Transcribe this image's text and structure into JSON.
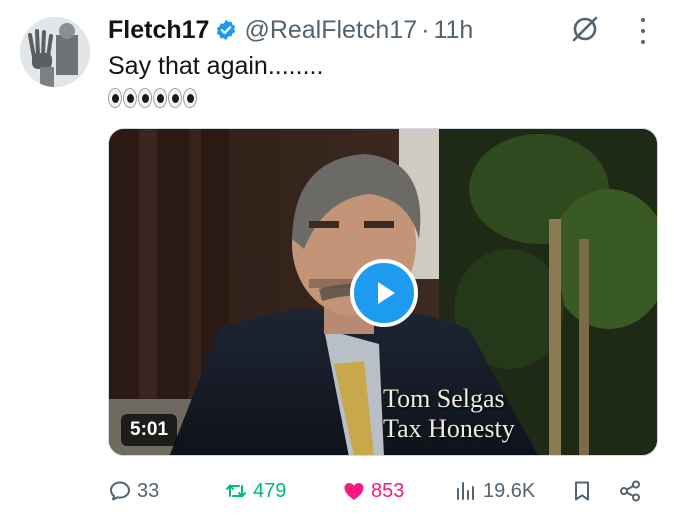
{
  "post": {
    "display_name": "Fletch17",
    "handle": "@RealFletch17",
    "separator": "·",
    "time": "11h",
    "text": "Say that again........",
    "emoji_count": 6
  },
  "media": {
    "duration": "5:01",
    "caption_line1": "Tom Selgas",
    "caption_line2": "Tax Honesty"
  },
  "actions": {
    "replies": "33",
    "reposts": "479",
    "likes": "853",
    "views": "19.6K"
  },
  "colors": {
    "accent": "#1d9bf0",
    "repost": "#00ba7c",
    "like": "#f91880",
    "muted": "#536471"
  },
  "icons": [
    "verified-badge-icon",
    "grok-icon",
    "more-icon",
    "eyes-emoji-icon",
    "play-icon",
    "reply-icon",
    "repost-icon",
    "like-icon",
    "views-icon",
    "bookmark-icon",
    "share-icon"
  ]
}
